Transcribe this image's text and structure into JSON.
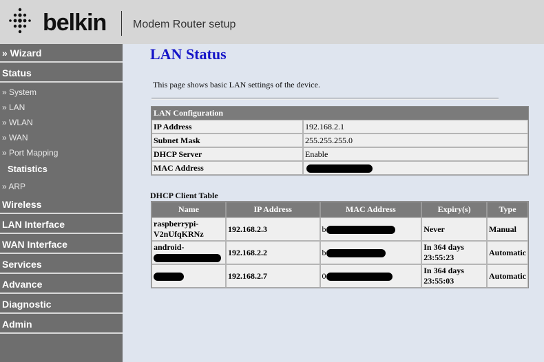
{
  "header": {
    "brand": "belkin",
    "title": "Modem Router setup"
  },
  "sidebar": {
    "items": [
      {
        "label": "» Wizard",
        "type": "main"
      },
      {
        "label": "Status",
        "type": "main"
      },
      {
        "label": "» System",
        "type": "sub"
      },
      {
        "label": "» LAN",
        "type": "sub"
      },
      {
        "label": "» WLAN",
        "type": "sub"
      },
      {
        "label": "» WAN",
        "type": "sub"
      },
      {
        "label": "» Port Mapping",
        "type": "sub"
      },
      {
        "label": "Statistics",
        "type": "stat"
      },
      {
        "label": "» ARP",
        "type": "sub"
      },
      {
        "label": "Wireless",
        "type": "main"
      },
      {
        "label": "LAN Interface",
        "type": "main"
      },
      {
        "label": "WAN Interface",
        "type": "main"
      },
      {
        "label": "Services",
        "type": "main"
      },
      {
        "label": "Advance",
        "type": "main"
      },
      {
        "label": "Diagnostic",
        "type": "main"
      },
      {
        "label": "Admin",
        "type": "main"
      }
    ]
  },
  "main": {
    "title": "LAN Status",
    "description": "This page shows basic LAN settings of the device."
  },
  "lan_config": {
    "header": "LAN Configuration",
    "rows": [
      {
        "label": "IP Address",
        "value": "192.168.2.1"
      },
      {
        "label": "Subnet Mask",
        "value": "255.255.255.0"
      },
      {
        "label": "DHCP Server",
        "value": "Enable"
      },
      {
        "label": "MAC Address",
        "value": ""
      }
    ]
  },
  "dhcp": {
    "title": "DHCP Client Table",
    "columns": [
      "Name",
      "IP Address",
      "MAC Address",
      "Expiry(s)",
      "Type"
    ],
    "rows": [
      {
        "name_line1": "raspberrypi-",
        "name_line2": "V2nUfqKRNz",
        "ip": "192.168.2.3",
        "mac_prefix": "b",
        "expiry_line1": "Never",
        "expiry_line2": "",
        "type": "Manual"
      },
      {
        "name_line1": "android-",
        "name_line2": "",
        "ip": "192.168.2.2",
        "mac_prefix": "b",
        "expiry_line1": "In 364 days",
        "expiry_line2": "23:55:23",
        "type": "Automatic"
      },
      {
        "name_line1": "",
        "name_line2": "",
        "ip": "192.168.2.7",
        "mac_prefix": "0",
        "expiry_line1": "In 364 days",
        "expiry_line2": "23:55:03",
        "type": "Automatic"
      }
    ]
  }
}
